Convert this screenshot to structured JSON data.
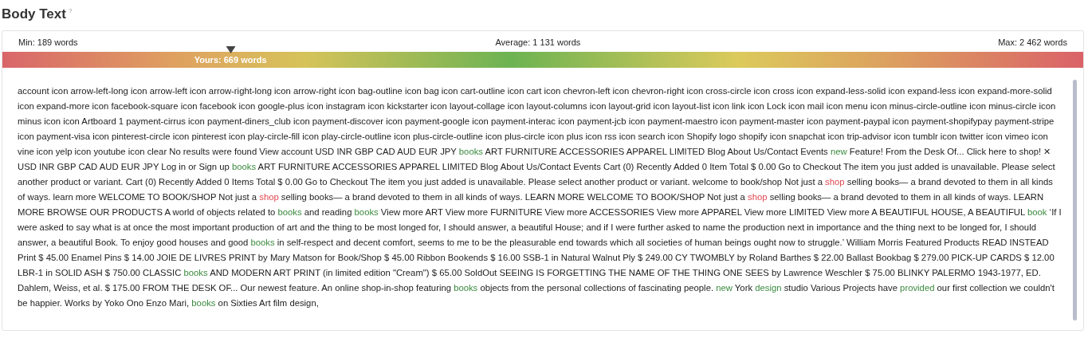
{
  "title": "Body Text",
  "help_mark": "?",
  "stats": {
    "min": "Min: 189 words",
    "average": "Average: 1 131 words",
    "max": "Max: 2 462 words",
    "yours": "Yours: 669 words",
    "level": 0.211
  },
  "text_segments": [
    {
      "kind": "plain",
      "text": "account icon arrow-left-long icon arrow-left icon arrow-right-long icon arrow-right icon bag-outline icon bag icon cart-outline icon cart icon chevron-left icon chevron-right icon cross-circle icon cross icon expand-less-solid icon expand-less icon expand-more-solid icon expand-more icon facebook-square icon facebook icon google-plus icon instagram icon kickstarter icon layout-collage icon layout-columns icon layout-grid icon layout-list icon link icon Lock icon mail icon menu icon minus-circle-outline icon minus-circle icon minus icon icon Artboard 1 payment-cirrus icon payment-diners_club icon payment-discover icon payment-google icon payment-interac icon payment-jcb icon payment-maestro icon payment-master icon payment-paypal icon payment-shopifypay payment-stripe icon payment-visa icon pinterest-circle icon pinterest icon play-circle-fill icon play-circle-outline icon plus-circle-outline icon plus-circle icon plus icon rss icon search icon Shopify logo shopify icon snapchat icon trip-advisor icon tumblr icon twitter icon vimeo icon vine icon yelp icon youtube icon clear No results were found View account USD INR GBP CAD AUD EUR JPY "
    },
    {
      "kind": "good",
      "text": "books"
    },
    {
      "kind": "plain",
      "text": " ART FURNITURE ACCESSORIES APPAREL LIMITED Blog About Us/Contact Events "
    },
    {
      "kind": "good",
      "text": "new"
    },
    {
      "kind": "plain",
      "text": " Feature! From the Desk Of... Click here to shop! ✕ USD INR GBP CAD AUD EUR JPY Log in or Sign up "
    },
    {
      "kind": "good",
      "text": "books"
    },
    {
      "kind": "plain",
      "text": " ART FURNITURE ACCESSORIES APPAREL LIMITED Blog About Us/Contact Events Cart (0) Recently Added 0 Item Total $ 0.00 Go to Checkout The item you just added is unavailable. Please select another product or variant. Cart (0) Recently Added 0 Items Total $ 0.00 Go to Checkout The item you just added is unavailable. Please select another product or variant. welcome to book/shop Not just a "
    },
    {
      "kind": "bad",
      "text": "shop"
    },
    {
      "kind": "plain",
      "text": " selling books— a brand devoted to them in all kinds of ways. learn more WELCOME TO BOOK/SHOP Not just a "
    },
    {
      "kind": "bad",
      "text": "shop"
    },
    {
      "kind": "plain",
      "text": " selling books— a brand devoted to them in all kinds of ways. LEARN MORE WELCOME TO BOOK/SHOP Not just a "
    },
    {
      "kind": "bad",
      "text": "shop"
    },
    {
      "kind": "plain",
      "text": " selling books— a brand devoted to them in all kinds of ways. LEARN MORE BROWSE OUR PRODUCTS A world of objects related to "
    },
    {
      "kind": "good",
      "text": "books"
    },
    {
      "kind": "plain",
      "text": " and reading "
    },
    {
      "kind": "good",
      "text": "books"
    },
    {
      "kind": "plain",
      "text": " View more ART View more FURNITURE View more ACCESSORIES View more APPAREL View more LIMITED View more A BEAUTIFUL HOUSE, A BEAUTIFUL "
    },
    {
      "kind": "good",
      "text": "book"
    },
    {
      "kind": "plain",
      "text": " ‘If I were asked to say what is at once the most important production of art and the thing to be most longed for, I should answer, a beautiful House; and if I were further asked to name the production next in importance and the thing next to be longed for, I should answer, a beautiful Book. To enjoy good houses and good "
    },
    {
      "kind": "good",
      "text": "books"
    },
    {
      "kind": "plain",
      "text": " in self-respect and decent comfort, seems to me to be the pleasurable end towards which all societies of human beings ought now to struggle.’ William Morris Featured Products READ INSTEAD Print $ 45.00 Enamel Pins $ 14.00 JOIE DE LIVRES PRINT by Mary Matson for Book/Shop $ 45.00 Ribbon Bookends $ 16.00 SSB-1 in Natural Walnut Ply $ 249.00 CY TWOMBLY by Roland Barthes $ 22.00 Ballast Bookbag $ 279.00 PICK-UP CARDS $ 12.00 LBR-1 in SOLID ASH $ 750.00 CLASSIC "
    },
    {
      "kind": "good",
      "text": "books"
    },
    {
      "kind": "plain",
      "text": " AND MODERN ART PRINT (in limited edition \"Cream\") $ 65.00 SoldOut SEEING IS FORGETTING THE NAME OF THE THING ONE SEES by Lawrence Weschler $ 75.00 BLINKY PALERMO 1943-1977, ED. Dahlem, Weiss, et al. $ 175.00 FROM THE DESK OF... Our newest feature. An online shop-in-shop featuring "
    },
    {
      "kind": "good",
      "text": "books"
    },
    {
      "kind": "plain",
      "text": " objects from the personal collections of fascinating people. "
    },
    {
      "kind": "good",
      "text": "new"
    },
    {
      "kind": "plain",
      "text": " York "
    },
    {
      "kind": "good",
      "text": "design"
    },
    {
      "kind": "plain",
      "text": " studio Various Projects have "
    },
    {
      "kind": "good",
      "text": "provided"
    },
    {
      "kind": "plain",
      "text": " our first collection we couldn't be happier. Works by Yoko Ono Enzo Mari, "
    },
    {
      "kind": "good",
      "text": "books"
    },
    {
      "kind": "plain",
      "text": " on Sixties Art film design,"
    }
  ]
}
